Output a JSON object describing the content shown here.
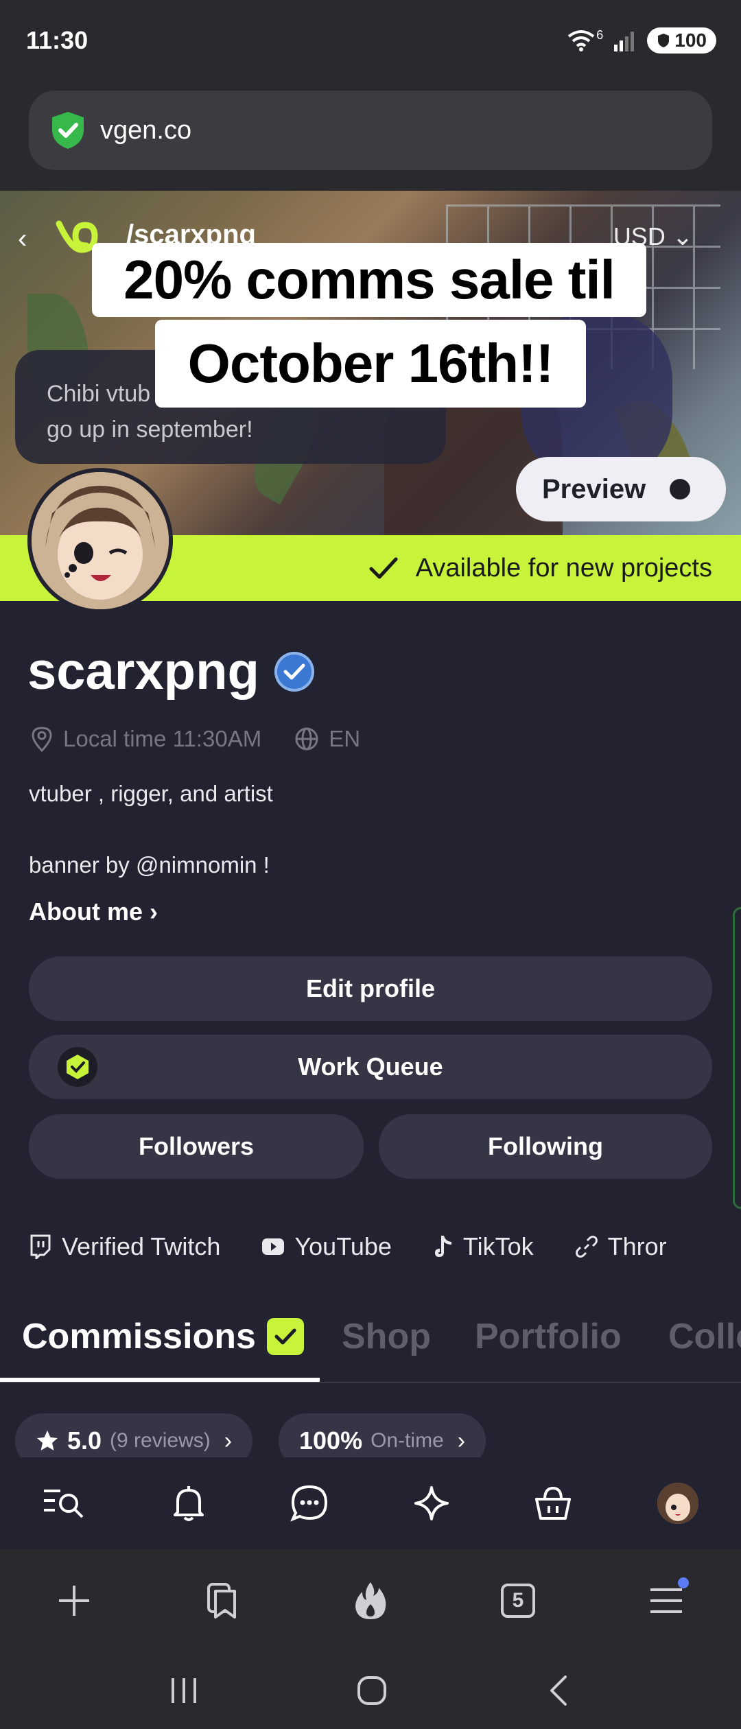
{
  "status_bar": {
    "time": "11:30",
    "wifi_label": "6",
    "battery": "100"
  },
  "browser": {
    "url": "vgen.co",
    "tab_count": "5"
  },
  "banner": {
    "handle": "/scarxpng",
    "currency": "USD",
    "notice": "Chibi vtuber prices will go up in september!",
    "notice_line1": "Chibi vtub",
    "notice_line2": "go up in september!",
    "preview_label": "Preview"
  },
  "overlay": {
    "line1": "20% comms sale til",
    "line2": "October 16th!!"
  },
  "availability": "Available for new projects",
  "profile": {
    "username": "scarxpng",
    "local_time": "Local time 11:30AM",
    "language": "EN",
    "bio_line1": "vtuber , rigger, and artist",
    "bio_line2": "banner by @nimnomin !",
    "about_label": "About me"
  },
  "buttons": {
    "edit_profile": "Edit profile",
    "work_queue": "Work Queue",
    "followers": "Followers",
    "following": "Following"
  },
  "links": [
    "Verified Twitch",
    "YouTube",
    "TikTok",
    "Thror"
  ],
  "tabs": [
    "Commissions",
    "Shop",
    "Portfolio",
    "Colle"
  ],
  "stats": {
    "rating": "5.0",
    "reviews": "(9 reviews)",
    "ontime_value": "100%",
    "ontime_label": "On-time"
  },
  "colors": {
    "accent": "#c7f43a",
    "background": "#222230",
    "button": "#353545"
  }
}
